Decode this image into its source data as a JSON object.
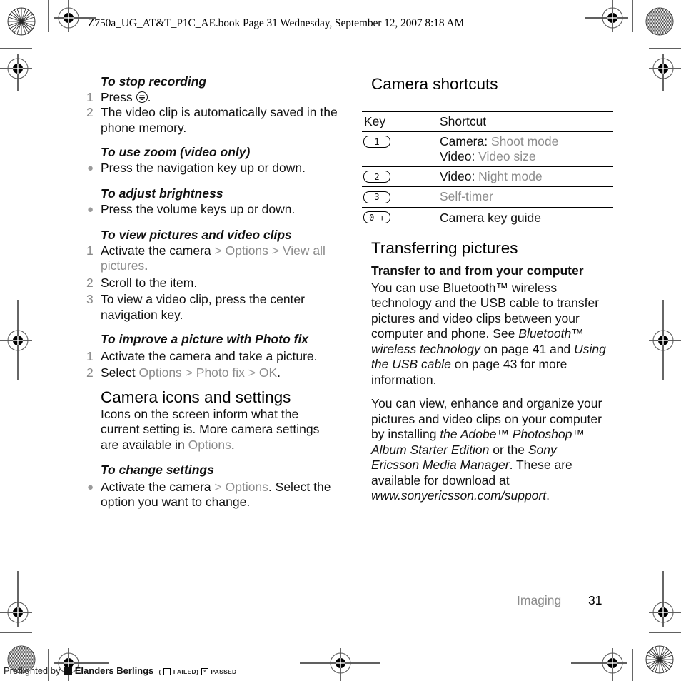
{
  "slug": {
    "text": "Z750a_UG_AT&T_P1C_AE.book  Page 31  Wednesday, September 12, 2007  8:18 AM"
  },
  "left": {
    "stop_recording": {
      "title": "To stop recording",
      "steps": [
        {
          "num": "1",
          "before": "Press ",
          "icon": "camera-key-icon",
          "after": "."
        },
        {
          "num": "2",
          "text": "The video clip is automatically saved in the phone memory."
        }
      ]
    },
    "zoom": {
      "title": "To use zoom (video only)",
      "bullet": "Press the navigation key up or down."
    },
    "brightness": {
      "title": "To adjust brightness",
      "bullet": "Press the volume keys up or down."
    },
    "view": {
      "title": "To view pictures and video clips",
      "step1": {
        "num": "1",
        "text": "Activate the camera",
        "sep": " > ",
        "opt1": "Options",
        "opt2": "View all pictures",
        "end": "."
      },
      "step2": {
        "num": "2",
        "text": "Scroll to the item."
      },
      "step3": {
        "num": "3",
        "text": "To view a video clip, press the center navigation key."
      }
    },
    "photofix": {
      "title": "To improve a picture with Photo fix",
      "step1": {
        "num": "1",
        "text": "Activate the camera and take a picture."
      },
      "step2": {
        "num": "2",
        "text": "Select ",
        "opt1": "Options",
        "sep": " > ",
        "opt2": "Photo fix",
        "opt3": "OK",
        "end": "."
      }
    },
    "icons_settings": {
      "heading": "Camera icons and settings",
      "para_text": "Icons on the screen inform what the current setting is. More camera settings are available in ",
      "para_opt": "Options",
      "para_end": "."
    },
    "change_settings": {
      "title": "To change settings",
      "text": "Activate the camera",
      "sep": " > ",
      "opt": "Options",
      "rest": ". Select the option you want to change."
    }
  },
  "right": {
    "shortcuts": {
      "heading": "Camera shortcuts",
      "col_key": "Key",
      "col_shortcut": "Shortcut",
      "rows": [
        {
          "key": "1",
          "lines": [
            {
              "label": "Camera: ",
              "value": "Shoot mode"
            },
            {
              "label": "Video: ",
              "value": "Video size"
            }
          ]
        },
        {
          "key": "2",
          "lines": [
            {
              "label": "Video: ",
              "value": "Night mode"
            }
          ]
        },
        {
          "key": "3",
          "lines": [
            {
              "label": "",
              "value": "Self-timer"
            }
          ]
        },
        {
          "key": "0 +",
          "lines": [
            {
              "label": "Camera key guide",
              "value": ""
            }
          ]
        }
      ]
    },
    "transfer": {
      "heading": "Transferring pictures",
      "subheading": "Transfer to and from your computer",
      "p1_a": "You can use Bluetooth™ wireless technology and the USB cable to transfer pictures and video clips between your computer and phone. See ",
      "p1_ref1": "Bluetooth™ wireless technology",
      "p1_b": " on page 41 and ",
      "p1_ref2": "Using the USB cable",
      "p1_c": " on page 43 for more information.",
      "p2_a": "You can view, enhance and organize your pictures and video clips on your computer by installing ",
      "p2_ref1": "the Adobe™ Photoshop™ Album Starter Edition",
      "p2_b": " or the ",
      "p2_ref2": "Sony Ericsson Media Manager",
      "p2_c": ". These are available for download at ",
      "p2_url": "www.sonyericsson.com/support",
      "p2_d": "."
    }
  },
  "footer": {
    "section": "Imaging",
    "page": "31"
  },
  "preflight": {
    "label": "Preflighted by",
    "brand": "Elanders Berlings",
    "open": "(",
    "failed": "FAILED",
    "close": ")",
    "passed": "PASSED",
    "failed_checked": false,
    "passed_checked": true,
    "check_mark": "×"
  },
  "colors": {
    "menu_highlight": "#8c8c8c",
    "text": "#111111"
  }
}
